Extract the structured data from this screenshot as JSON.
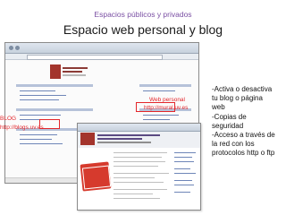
{
  "slide": {
    "subtitle": "Espacios públicos y privados",
    "title": "Espacio web personal y blog"
  },
  "callouts": {
    "web_personal": "Web personal",
    "web_personal_url": "http://mural.uv.es",
    "blog": "BLOG",
    "blog_url": "http://blogs.uv.es"
  },
  "features": [
    "-Activa o desactiva",
    "tu blog o página",
    "web",
    "-Copias de",
    "seguridad",
    "-Acceso a través de",
    "la red con los",
    "protocolos http o ftp"
  ],
  "colors": {
    "accent_red": "#e3262b",
    "subtitle_purple": "#7a4fa3",
    "brand_red": "#a3342c"
  }
}
